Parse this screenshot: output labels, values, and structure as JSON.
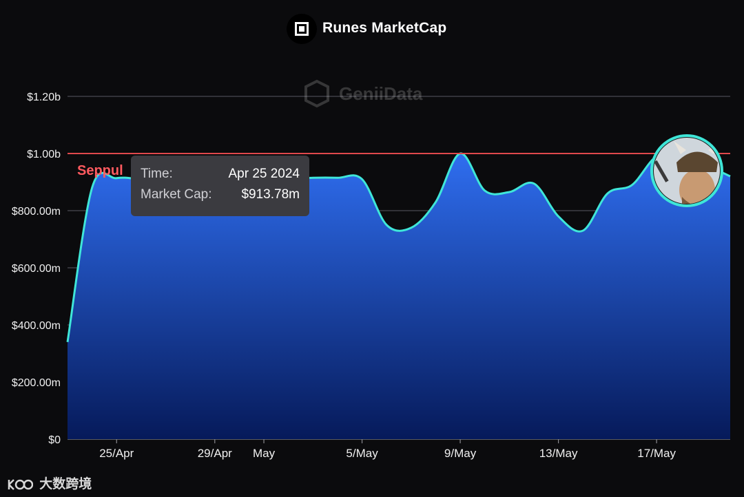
{
  "header": {
    "title": "Runes MarketCap"
  },
  "watermark": "GeniiData",
  "ref_line_label": "Seppul",
  "tooltip": {
    "time_label": "Time:",
    "time_value": "Apr 25 2024",
    "cap_label": "Market Cap:",
    "cap_value": "$913.78m"
  },
  "footer": {
    "brand": "大数跨境"
  },
  "avatar": {
    "icon": "warrior-avatar-icon"
  },
  "colors": {
    "line": "#3fe6d8",
    "ref_line": "#e0484c",
    "fill_top": "#2f6ef0",
    "fill_bottom": "#061a5a",
    "ref_label": "#ff5a5f"
  },
  "chart_data": {
    "type": "area",
    "title": "Runes MarketCap",
    "xlabel": "",
    "ylabel": "",
    "ylim": [
      0,
      1200000000
    ],
    "yticks": [
      0,
      200000000,
      400000000,
      600000000,
      800000000,
      1000000000,
      1200000000
    ],
    "ytick_labels": [
      "$0",
      "$200.00m",
      "$400.00m",
      "$600.00m",
      "$800.00m",
      "$1.00b",
      "$1.20b"
    ],
    "xlim": [
      "2024-04-23",
      "2024-05-20"
    ],
    "xticks": [
      "2024-04-25",
      "2024-04-29",
      "2024-05-01",
      "2024-05-05",
      "2024-05-09",
      "2024-05-13",
      "2024-05-17"
    ],
    "xtick_labels": [
      "25/Apr",
      "29/Apr",
      "May",
      "5/May",
      "9/May",
      "13/May",
      "17/May"
    ],
    "reference_line": {
      "value": 1000000000,
      "label": "Seppul"
    },
    "grid": true,
    "series": [
      {
        "x": [
          "2024-04-23",
          "2024-04-24",
          "2024-04-25",
          "2024-04-26",
          "2024-04-27",
          "2024-04-28",
          "2024-04-29",
          "2024-04-30",
          "2024-05-01",
          "2024-05-02",
          "2024-05-03",
          "2024-05-04",
          "2024-05-05",
          "2024-05-06",
          "2024-05-07",
          "2024-05-08",
          "2024-05-09",
          "2024-05-10",
          "2024-05-11",
          "2024-05-12",
          "2024-05-13",
          "2024-05-14",
          "2024-05-15",
          "2024-05-16",
          "2024-05-17",
          "2024-05-18",
          "2024-05-19",
          "2024-05-20"
        ],
        "values": [
          340000000,
          880000000,
          913780000,
          910000000,
          905000000,
          905000000,
          905000000,
          905000000,
          905000000,
          910000000,
          915000000,
          915000000,
          910000000,
          750000000,
          740000000,
          830000000,
          1000000000,
          870000000,
          865000000,
          895000000,
          780000000,
          730000000,
          860000000,
          890000000,
          990000000,
          990000000,
          960000000,
          920000000
        ]
      }
    ]
  }
}
